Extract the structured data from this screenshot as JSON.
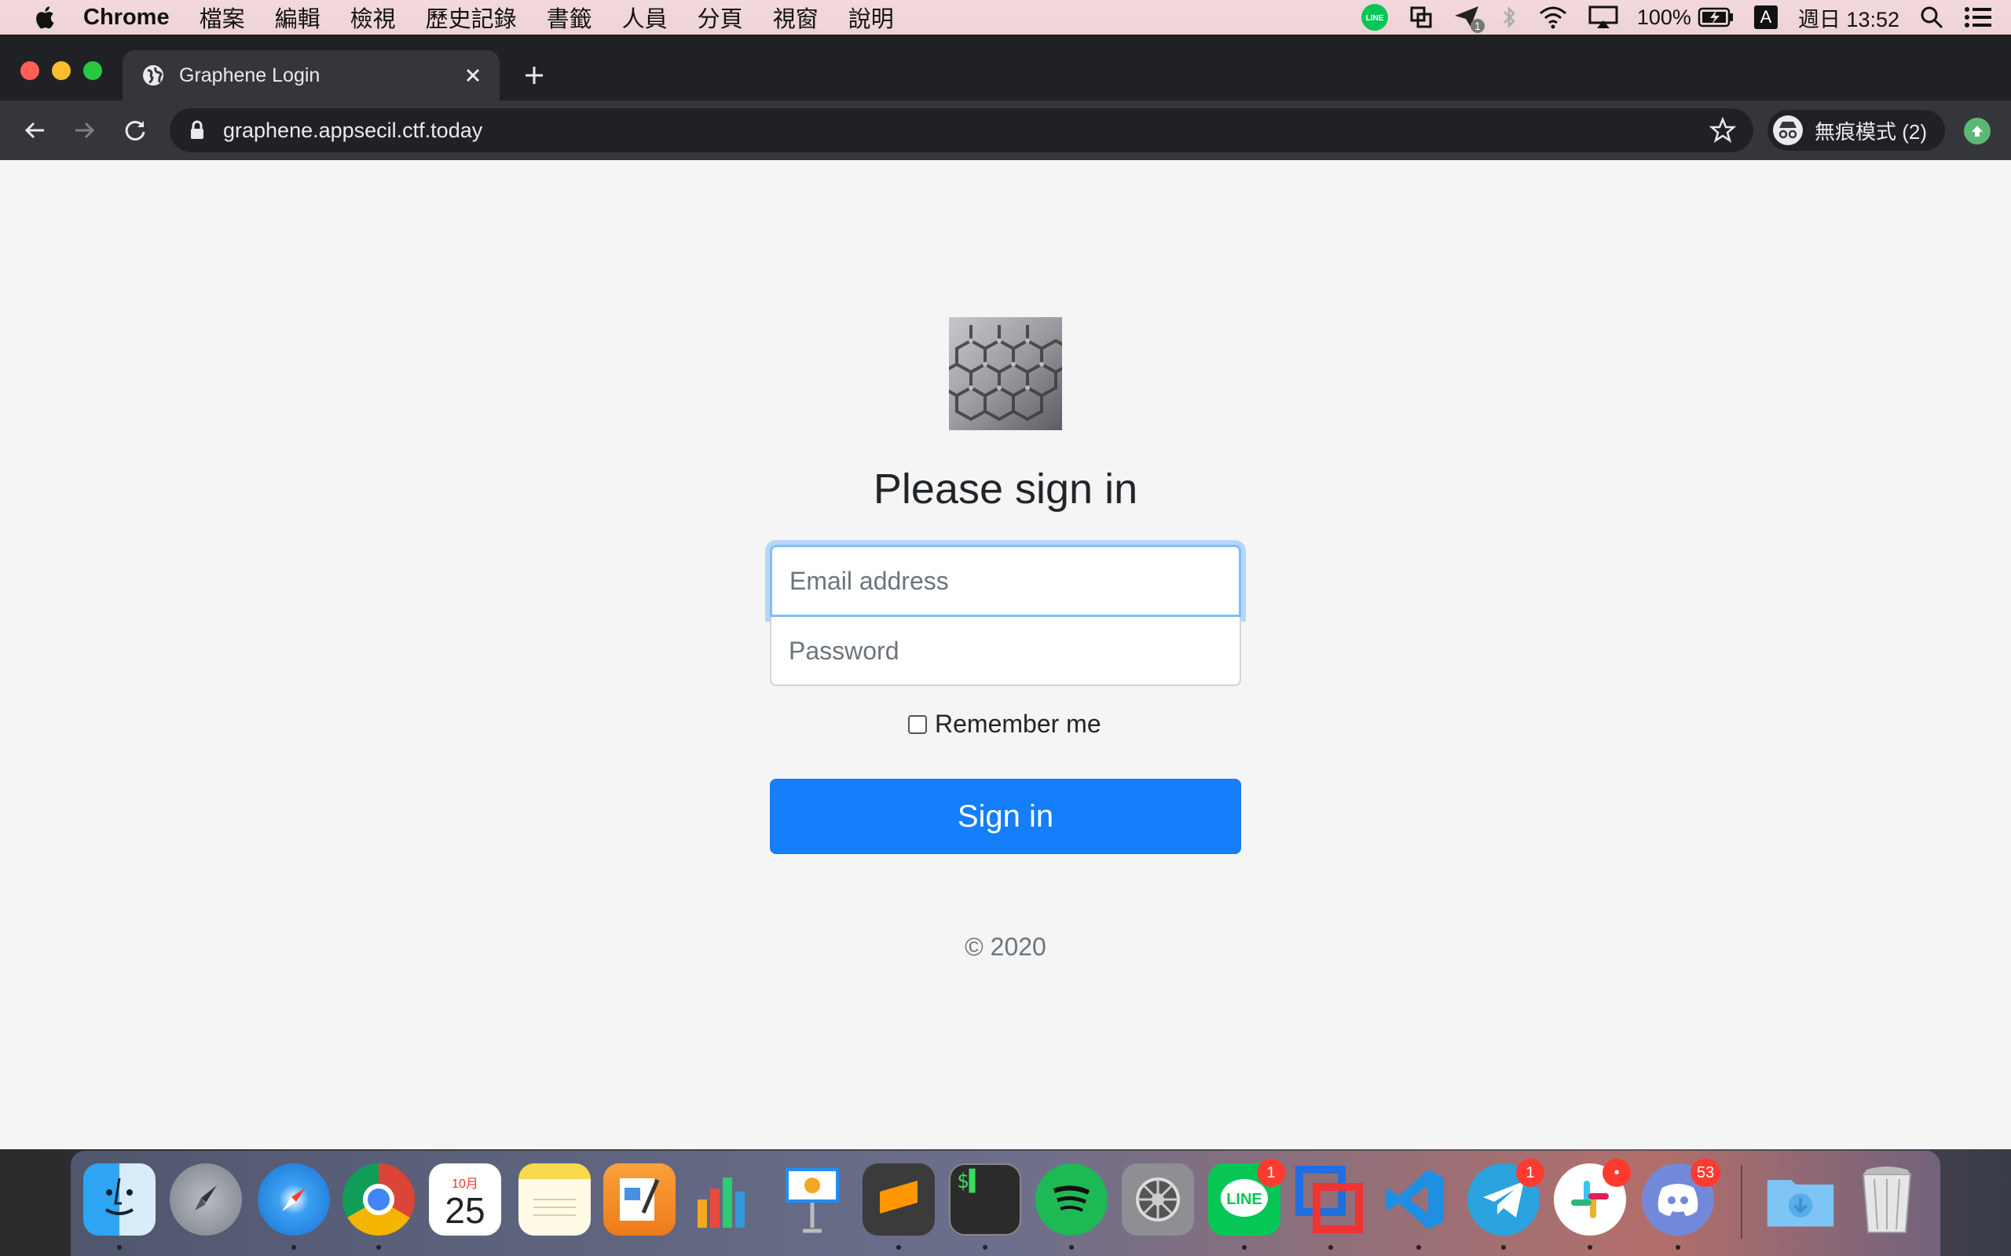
{
  "menubar": {
    "app_name": "Chrome",
    "items": [
      "檔案",
      "編輯",
      "檢視",
      "歷史記錄",
      "書籤",
      "人員",
      "分頁",
      "視窗",
      "說明"
    ],
    "battery": "100%",
    "input_source": "A",
    "datetime": "週日 13:52",
    "airdrop_badge": "1"
  },
  "browser": {
    "tab_title": "Graphene Login",
    "url": "graphene.appsecil.ctf.today",
    "incognito_label": "無痕模式 (2)"
  },
  "page": {
    "heading": "Please sign in",
    "email_placeholder": "Email address",
    "password_placeholder": "Password",
    "remember_label": "Remember me",
    "signin_label": "Sign in",
    "copyright": "© 2020"
  },
  "dock": {
    "calendar_month": "10月",
    "calendar_day": "25",
    "badges": {
      "line": "1",
      "telegram": "1",
      "slack": "•",
      "discord": "53"
    }
  },
  "colors": {
    "primary": "#147efb",
    "page_bg": "#f5f5f5",
    "browser_dark": "#202124",
    "toolbar": "#35363a"
  }
}
